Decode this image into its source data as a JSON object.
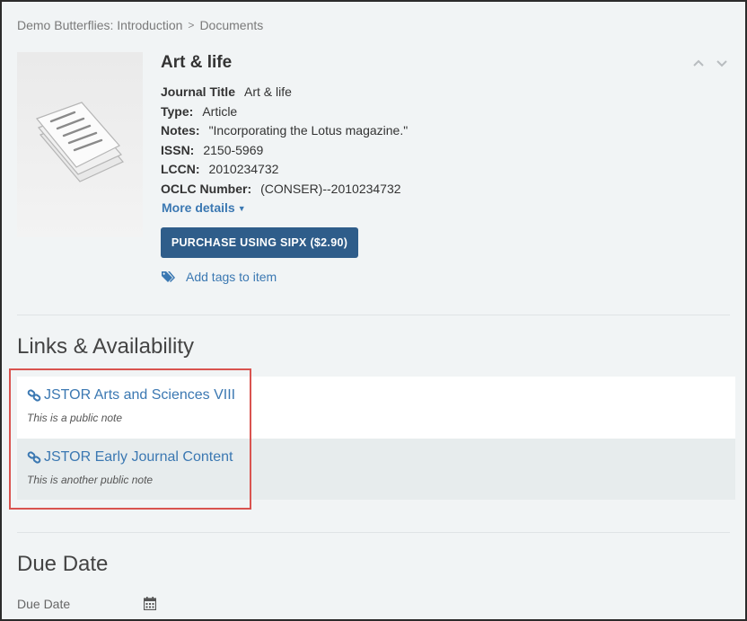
{
  "breadcrumb": {
    "items": [
      "Demo Butterflies: Introduction",
      "Documents"
    ],
    "separator": ">"
  },
  "record": {
    "title": "Art & life",
    "fields": [
      {
        "key": "Journal Title",
        "value": "Art & life"
      },
      {
        "key": "Type:",
        "value": "Article"
      },
      {
        "key": "Notes:",
        "value": "\"Incorporating the Lotus magazine.\""
      },
      {
        "key": "ISSN:",
        "value": "2150-5969"
      },
      {
        "key": "LCCN:",
        "value": "2010234732"
      },
      {
        "key": "OCLC Number:",
        "value": "(CONSER)--2010234732"
      }
    ],
    "more_details_label": "More details",
    "purchase_label": "PURCHASE USING SIPX ($2.90)",
    "add_tags_label": "Add tags to item",
    "thumbnail_icon": "document-stack-icon"
  },
  "links_section": {
    "heading": "Links & Availability",
    "links": [
      {
        "label": "JSTOR Arts and Sciences VIII",
        "note": "This is a public note",
        "icon": "link-icon"
      },
      {
        "label": "JSTOR Early Journal Content",
        "note": "This is another public note",
        "icon": "link-icon"
      }
    ]
  },
  "due_section": {
    "heading": "Due Date",
    "field_label": "Due Date",
    "icon": "calendar-icon"
  },
  "colors": {
    "accent": "#3b78b2",
    "button": "#2f5d8a",
    "highlight": "#d9534f",
    "background": "#f1f4f5"
  }
}
